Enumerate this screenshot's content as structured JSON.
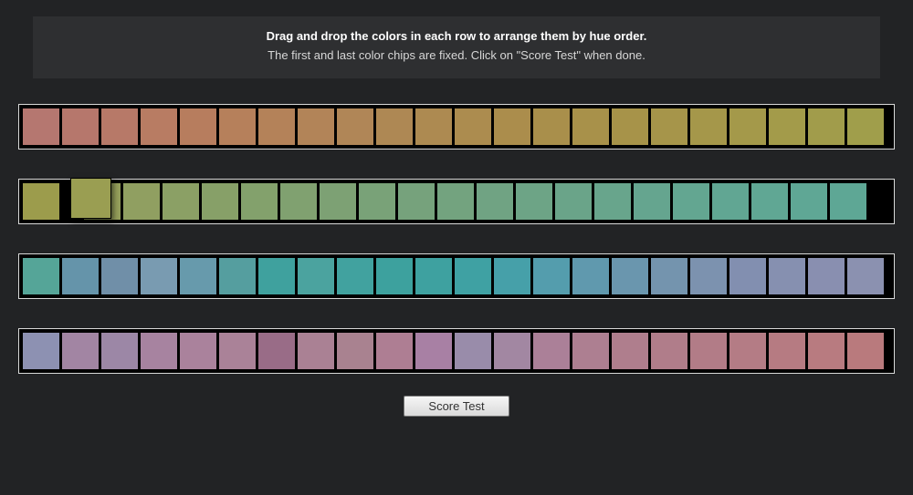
{
  "instructions": {
    "title": "Drag and drop the colors in each row to arrange them by hue order.",
    "subtitle": "The first and last color chips are fixed. Click on \"Score Test\" when done."
  },
  "rows": [
    {
      "fixed_first": "#b57770",
      "fixed_last": "#a09e4b",
      "chips": [
        "#b57770",
        "#b6776c",
        "#b77968",
        "#b87c63",
        "#b77d5e",
        "#b6805b",
        "#b48259",
        "#b28458",
        "#b08657",
        "#ae8854",
        "#ad8a51",
        "#ac8c4f",
        "#ab8d4c",
        "#a98f4b",
        "#a8914a",
        "#a79349",
        "#a6954a",
        "#a5974a",
        "#a4994a",
        "#a39b4a",
        "#a19c4b",
        "#a09e4b"
      ]
    },
    {
      "fixed_first": "#9c9c4c",
      "fixed_last": "#5ea795",
      "dragging_index": 1,
      "drag_color": "#9a9e52",
      "chips": [
        "#9c9c4c",
        "#9a9e52",
        "#959f5b",
        "#909f61",
        "#8ba065",
        "#87a068",
        "#83a16c",
        "#80a170",
        "#7da174",
        "#79a278",
        "#76a27c",
        "#73a37f",
        "#70a383",
        "#6da486",
        "#6aa489",
        "#68a58c",
        "#65a58f",
        "#63a691",
        "#61a693",
        "#60a794",
        "#5fa795",
        "#5ea795"
      ]
    },
    {
      "fixed_first": "#55a598",
      "fixed_last": "#8b91b0",
      "chips": [
        "#55a598",
        "#6594aa",
        "#708fa8",
        "#799bb1",
        "#679aac",
        "#559e9f",
        "#3fa19e",
        "#4ba39f",
        "#41a29f",
        "#3da19e",
        "#3ea1a0",
        "#3fa1a3",
        "#46a0a9",
        "#549dad",
        "#6099ae",
        "#6a96ae",
        "#7494ae",
        "#7c92af",
        "#828fb0",
        "#8690b0",
        "#898fb0",
        "#8b91b0"
      ]
    },
    {
      "fixed_first": "#8d91b2",
      "fixed_last": "#b97a7d",
      "chips": [
        "#8d91b2",
        "#a285a3",
        "#9c87a6",
        "#a783a0",
        "#aa829c",
        "#aa8298",
        "#996c87",
        "#aa8194",
        "#a98290",
        "#ae7e93",
        "#a880a4",
        "#998caa",
        "#a287a2",
        "#ab8098",
        "#ad7f91",
        "#af7e8d",
        "#b07d8a",
        "#b27c87",
        "#b47c85",
        "#b67b82",
        "#b87b80",
        "#b97a7d"
      ]
    }
  ],
  "button": {
    "score_label": "Score Test"
  }
}
